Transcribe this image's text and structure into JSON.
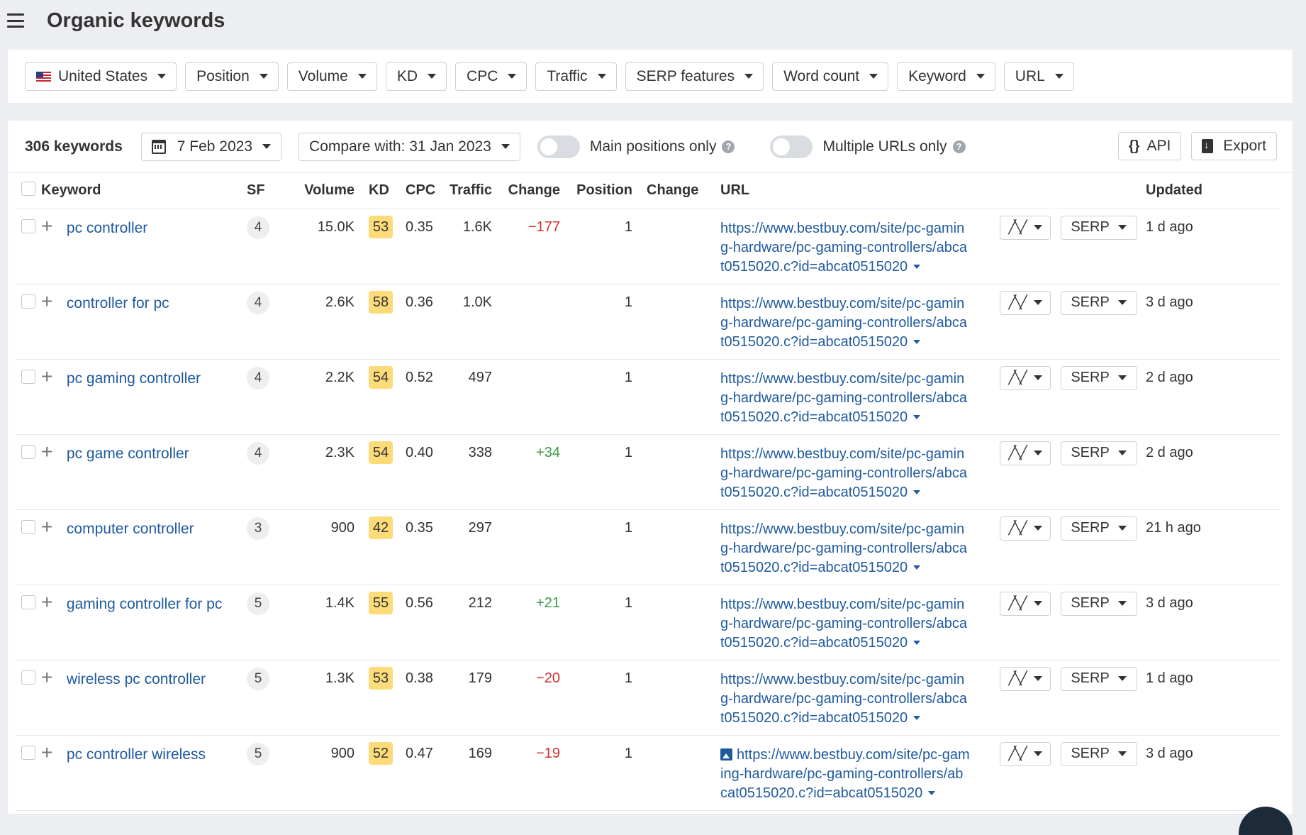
{
  "header": {
    "title": "Organic keywords"
  },
  "filters": [
    {
      "label": "United States",
      "flag": true
    },
    {
      "label": "Position"
    },
    {
      "label": "Volume"
    },
    {
      "label": "KD"
    },
    {
      "label": "CPC"
    },
    {
      "label": "Traffic"
    },
    {
      "label": "SERP features"
    },
    {
      "label": "Word count"
    },
    {
      "label": "Keyword"
    },
    {
      "label": "URL"
    }
  ],
  "toolbar": {
    "count": "306 keywords",
    "date": "7 Feb 2023",
    "compare": "Compare with: 31 Jan 2023",
    "main_positions": "Main positions only",
    "multiple_urls": "Multiple URLs only",
    "api": "API",
    "export": "Export"
  },
  "columns": {
    "keyword": "Keyword",
    "sf": "SF",
    "volume": "Volume",
    "kd": "KD",
    "cpc": "CPC",
    "traffic": "Traffic",
    "change": "Change",
    "position": "Position",
    "change2": "Change",
    "url": "URL",
    "updated": "Updated"
  },
  "rows": [
    {
      "keyword": "pc controller",
      "sf": "4",
      "volume": "15.0K",
      "kd": "53",
      "cpc": "0.35",
      "traffic": "1.6K",
      "change": "−177",
      "change_dir": "neg",
      "position": "1",
      "url": "https://www.bestbuy.com/site/pc-gaming-hardware/pc-gaming-controllers/abcat0515020.c?id=abcat0515020",
      "serp": "SERP",
      "updated": "1 d ago"
    },
    {
      "keyword": "controller for pc",
      "sf": "4",
      "volume": "2.6K",
      "kd": "58",
      "cpc": "0.36",
      "traffic": "1.0K",
      "change": "",
      "change_dir": "",
      "position": "1",
      "url": "https://www.bestbuy.com/site/pc-gaming-hardware/pc-gaming-controllers/abcat0515020.c?id=abcat0515020",
      "serp": "SERP",
      "updated": "3 d ago"
    },
    {
      "keyword": "pc gaming controller",
      "sf": "4",
      "volume": "2.2K",
      "kd": "54",
      "cpc": "0.52",
      "traffic": "497",
      "change": "",
      "change_dir": "",
      "position": "1",
      "url": "https://www.bestbuy.com/site/pc-gaming-hardware/pc-gaming-controllers/abcat0515020.c?id=abcat0515020",
      "serp": "SERP",
      "updated": "2 d ago"
    },
    {
      "keyword": "pc game controller",
      "sf": "4",
      "volume": "2.3K",
      "kd": "54",
      "cpc": "0.40",
      "traffic": "338",
      "change": "+34",
      "change_dir": "pos",
      "position": "1",
      "url": "https://www.bestbuy.com/site/pc-gaming-hardware/pc-gaming-controllers/abcat0515020.c?id=abcat0515020",
      "serp": "SERP",
      "updated": "2 d ago"
    },
    {
      "keyword": "computer controller",
      "sf": "3",
      "volume": "900",
      "kd": "42",
      "cpc": "0.35",
      "traffic": "297",
      "change": "",
      "change_dir": "",
      "position": "1",
      "url": "https://www.bestbuy.com/site/pc-gaming-hardware/pc-gaming-controllers/abcat0515020.c?id=abcat0515020",
      "serp": "SERP",
      "updated": "21 h ago"
    },
    {
      "keyword": "gaming controller for pc",
      "sf": "5",
      "volume": "1.4K",
      "kd": "55",
      "cpc": "0.56",
      "traffic": "212",
      "change": "+21",
      "change_dir": "pos",
      "position": "1",
      "url": "https://www.bestbuy.com/site/pc-gaming-hardware/pc-gaming-controllers/abcat0515020.c?id=abcat0515020",
      "serp": "SERP",
      "updated": "3 d ago"
    },
    {
      "keyword": "wireless pc controller",
      "sf": "5",
      "volume": "1.3K",
      "kd": "53",
      "cpc": "0.38",
      "traffic": "179",
      "change": "−20",
      "change_dir": "neg",
      "position": "1",
      "url": "https://www.bestbuy.com/site/pc-gaming-hardware/pc-gaming-controllers/abcat0515020.c?id=abcat0515020",
      "serp": "SERP",
      "updated": "1 d ago"
    },
    {
      "keyword": "pc controller wireless",
      "sf": "5",
      "volume": "900",
      "kd": "52",
      "cpc": "0.47",
      "traffic": "169",
      "change": "−19",
      "change_dir": "neg",
      "position": "1",
      "url": "https://www.bestbuy.com/site/pc-gaming-hardware/pc-gaming-controllers/abcat0515020.c?id=abcat0515020",
      "serp": "SERP",
      "updated": "3 d ago",
      "image_icon": true
    }
  ]
}
